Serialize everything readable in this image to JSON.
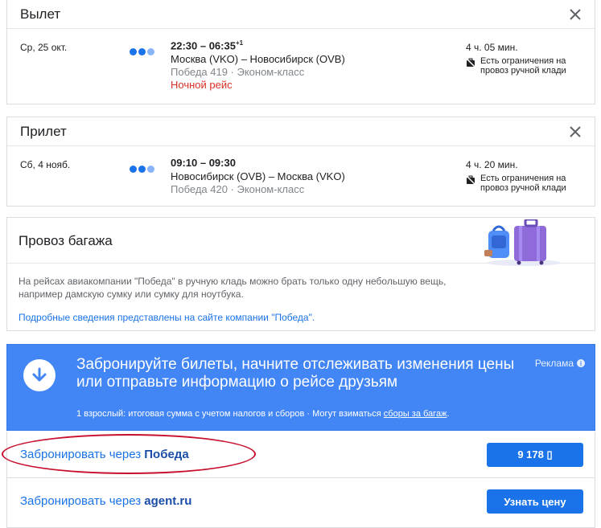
{
  "departure": {
    "title": "Вылет",
    "date": "Ср, 25 окт.",
    "times": "22:30 – 06:35",
    "times_sup": "+1",
    "route": "Москва (VKO) – Новосибирск (OVB)",
    "meta": "Победа 419 · Эконом-класс",
    "note": "Ночной рейс",
    "duration": "4 ч. 05 мин.",
    "restriction_line1": "Есть ограничения на",
    "restriction_line2": "провоз ручной клади"
  },
  "arrival": {
    "title": "Прилет",
    "date": "Сб, 4 нояб.",
    "times": "09:10 – 09:30",
    "route": "Новосибирск (OVB) – Москва (VKO)",
    "meta": "Победа 420 · Эконом-класс",
    "duration": "4 ч. 20 мин.",
    "restriction_line1": "Есть ограничения на",
    "restriction_line2": "провоз ручной клади"
  },
  "baggage": {
    "title": "Провоз багажа",
    "text_line1": "На рейсах авиакомпании \"Победа\" в ручную кладь можно брать только одну небольшую вещь,",
    "text_line2": "например дамскую сумку или сумку для ноутбука.",
    "link": "Подробные сведения представлены на сайте компании \"Победа\"."
  },
  "promo": {
    "title": "Забронируйте билеты, начните отслеживать изменения цены или отправьте информацию о рейсе друзьям",
    "ad_label": "Реклама",
    "sub_text": "1 взрослый: итоговая сумма с учетом налогов и сборов · Могут взиматься ",
    "sub_link": "сборы за багаж",
    "sub_end": "."
  },
  "booking": [
    {
      "prefix": "Забронировать через ",
      "provider": "Победа",
      "button": "9 178 ▯"
    },
    {
      "prefix": "Забронировать через ",
      "provider": "agent.ru",
      "button": "Узнать цену"
    }
  ],
  "colors": {
    "logo_dots": [
      "#1a73e8",
      "#1a73e8",
      "#8ab4f8"
    ],
    "accent": "#1a73e8",
    "promo_bg": "#4285f4",
    "night": "#d93025",
    "oval": "#c8102e"
  },
  "icons": {
    "close": "close-icon",
    "bag": "carry-on-bag-icon",
    "promo": "arrow-down-icon",
    "info": "info-icon",
    "illustration": "luggage-illustration"
  }
}
